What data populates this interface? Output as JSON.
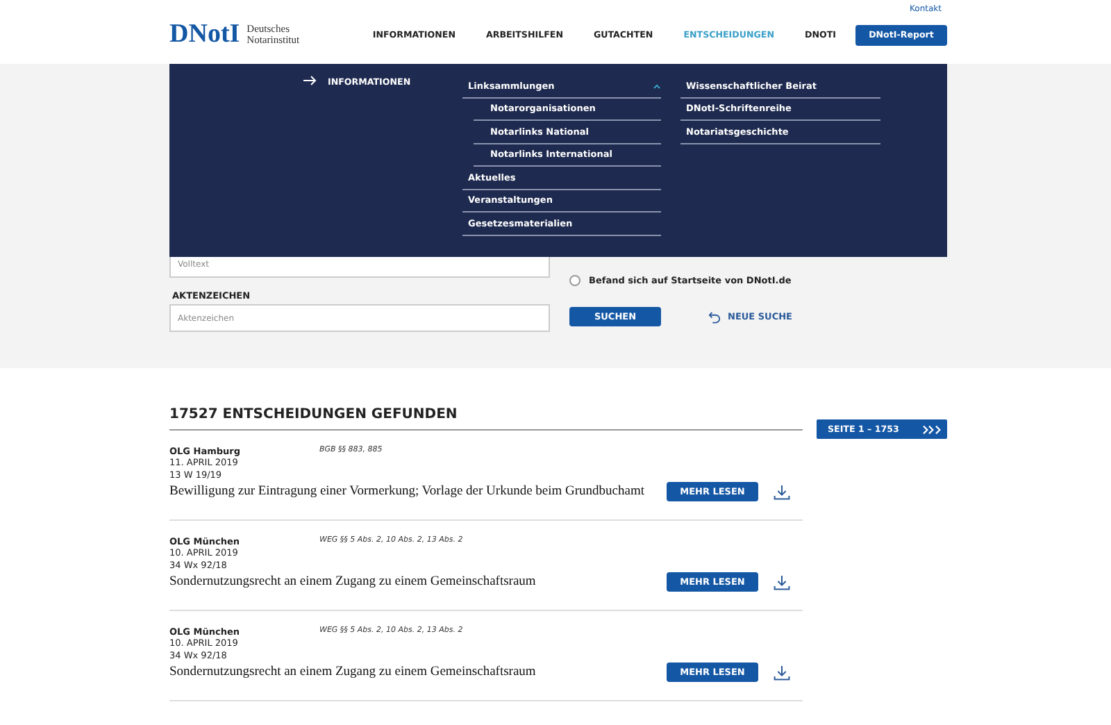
{
  "header": {
    "logo": {
      "mark": "DNotI",
      "line1": "Deutsches",
      "line2": "Notarinstitut"
    },
    "top_link": "Kontakt",
    "nav": [
      {
        "label": "INFORMATIONEN",
        "selected": false
      },
      {
        "label": "ARBEITSHILFEN",
        "selected": false
      },
      {
        "label": "GUTACHTEN",
        "selected": false
      },
      {
        "label": "ENTSCHEIDUNGEN",
        "selected": true
      },
      {
        "label": "DNOTI",
        "selected": false
      }
    ],
    "report_button": "DNotI-Report"
  },
  "mega_menu": {
    "section": "INFORMATIONEN",
    "columns": [
      [
        {
          "label": "Linksammlungen",
          "expanded": true,
          "children": [
            {
              "label": "Notarorganisationen"
            },
            {
              "label": "Notarlinks National"
            },
            {
              "label": "Notarlinks International"
            }
          ]
        },
        {
          "label": "Aktuelles"
        },
        {
          "label": "Veranstaltungen"
        },
        {
          "label": "Gesetzesmaterialien"
        }
      ],
      [
        {
          "label": "Wissenschaftlicher Beirat"
        },
        {
          "label": "DNotI-Schriftenreihe"
        },
        {
          "label": "Notariatsgeschichte"
        }
      ]
    ]
  },
  "search_form": {
    "volltext": {
      "placeholder": "Volltext"
    },
    "aktenzeichen": {
      "label": "AKTENZEICHEN",
      "placeholder": "Aktenzeichen"
    },
    "radio": {
      "label": "Befand sich auf Startseite von DNotI.de",
      "checked": false
    },
    "search_button": "SUCHEN",
    "reset_link": "NEUE SUCHE"
  },
  "results": {
    "heading": "17527 ENTSCHEIDUNGEN GEFUNDEN",
    "pager": "SEITE 1 – 1753",
    "items": [
      {
        "court": "OLG Hamburg",
        "date": "11. APRIL 2019",
        "file_no": "13 W 19/19",
        "norms": "BGB §§ 883, 885",
        "title": "Bewilligung zur Eintragung einer Vormerkung; Vorlage der Urkunde beim Grundbuchamt",
        "button": "MEHR LESEN"
      },
      {
        "court": "OLG München",
        "date": "10. APRIL 2019",
        "file_no": "34 Wx 92/18",
        "norms": "WEG §§ 5 Abs. 2, 10 Abs. 2, 13 Abs. 2",
        "title": "Sondernutzungsrecht an einem Zugang zu einem Gemeinschaftsraum",
        "button": "MEHR LESEN"
      },
      {
        "court": "OLG München",
        "date": "10. APRIL 2019",
        "file_no": "34 Wx 92/18",
        "norms": "WEG §§ 5 Abs. 2, 10 Abs. 2, 13 Abs. 2",
        "title": "Sondernutzungsrecht an einem Zugang zu einem Gemeinschaftsraum",
        "button": "MEHR LESEN"
      }
    ]
  }
}
